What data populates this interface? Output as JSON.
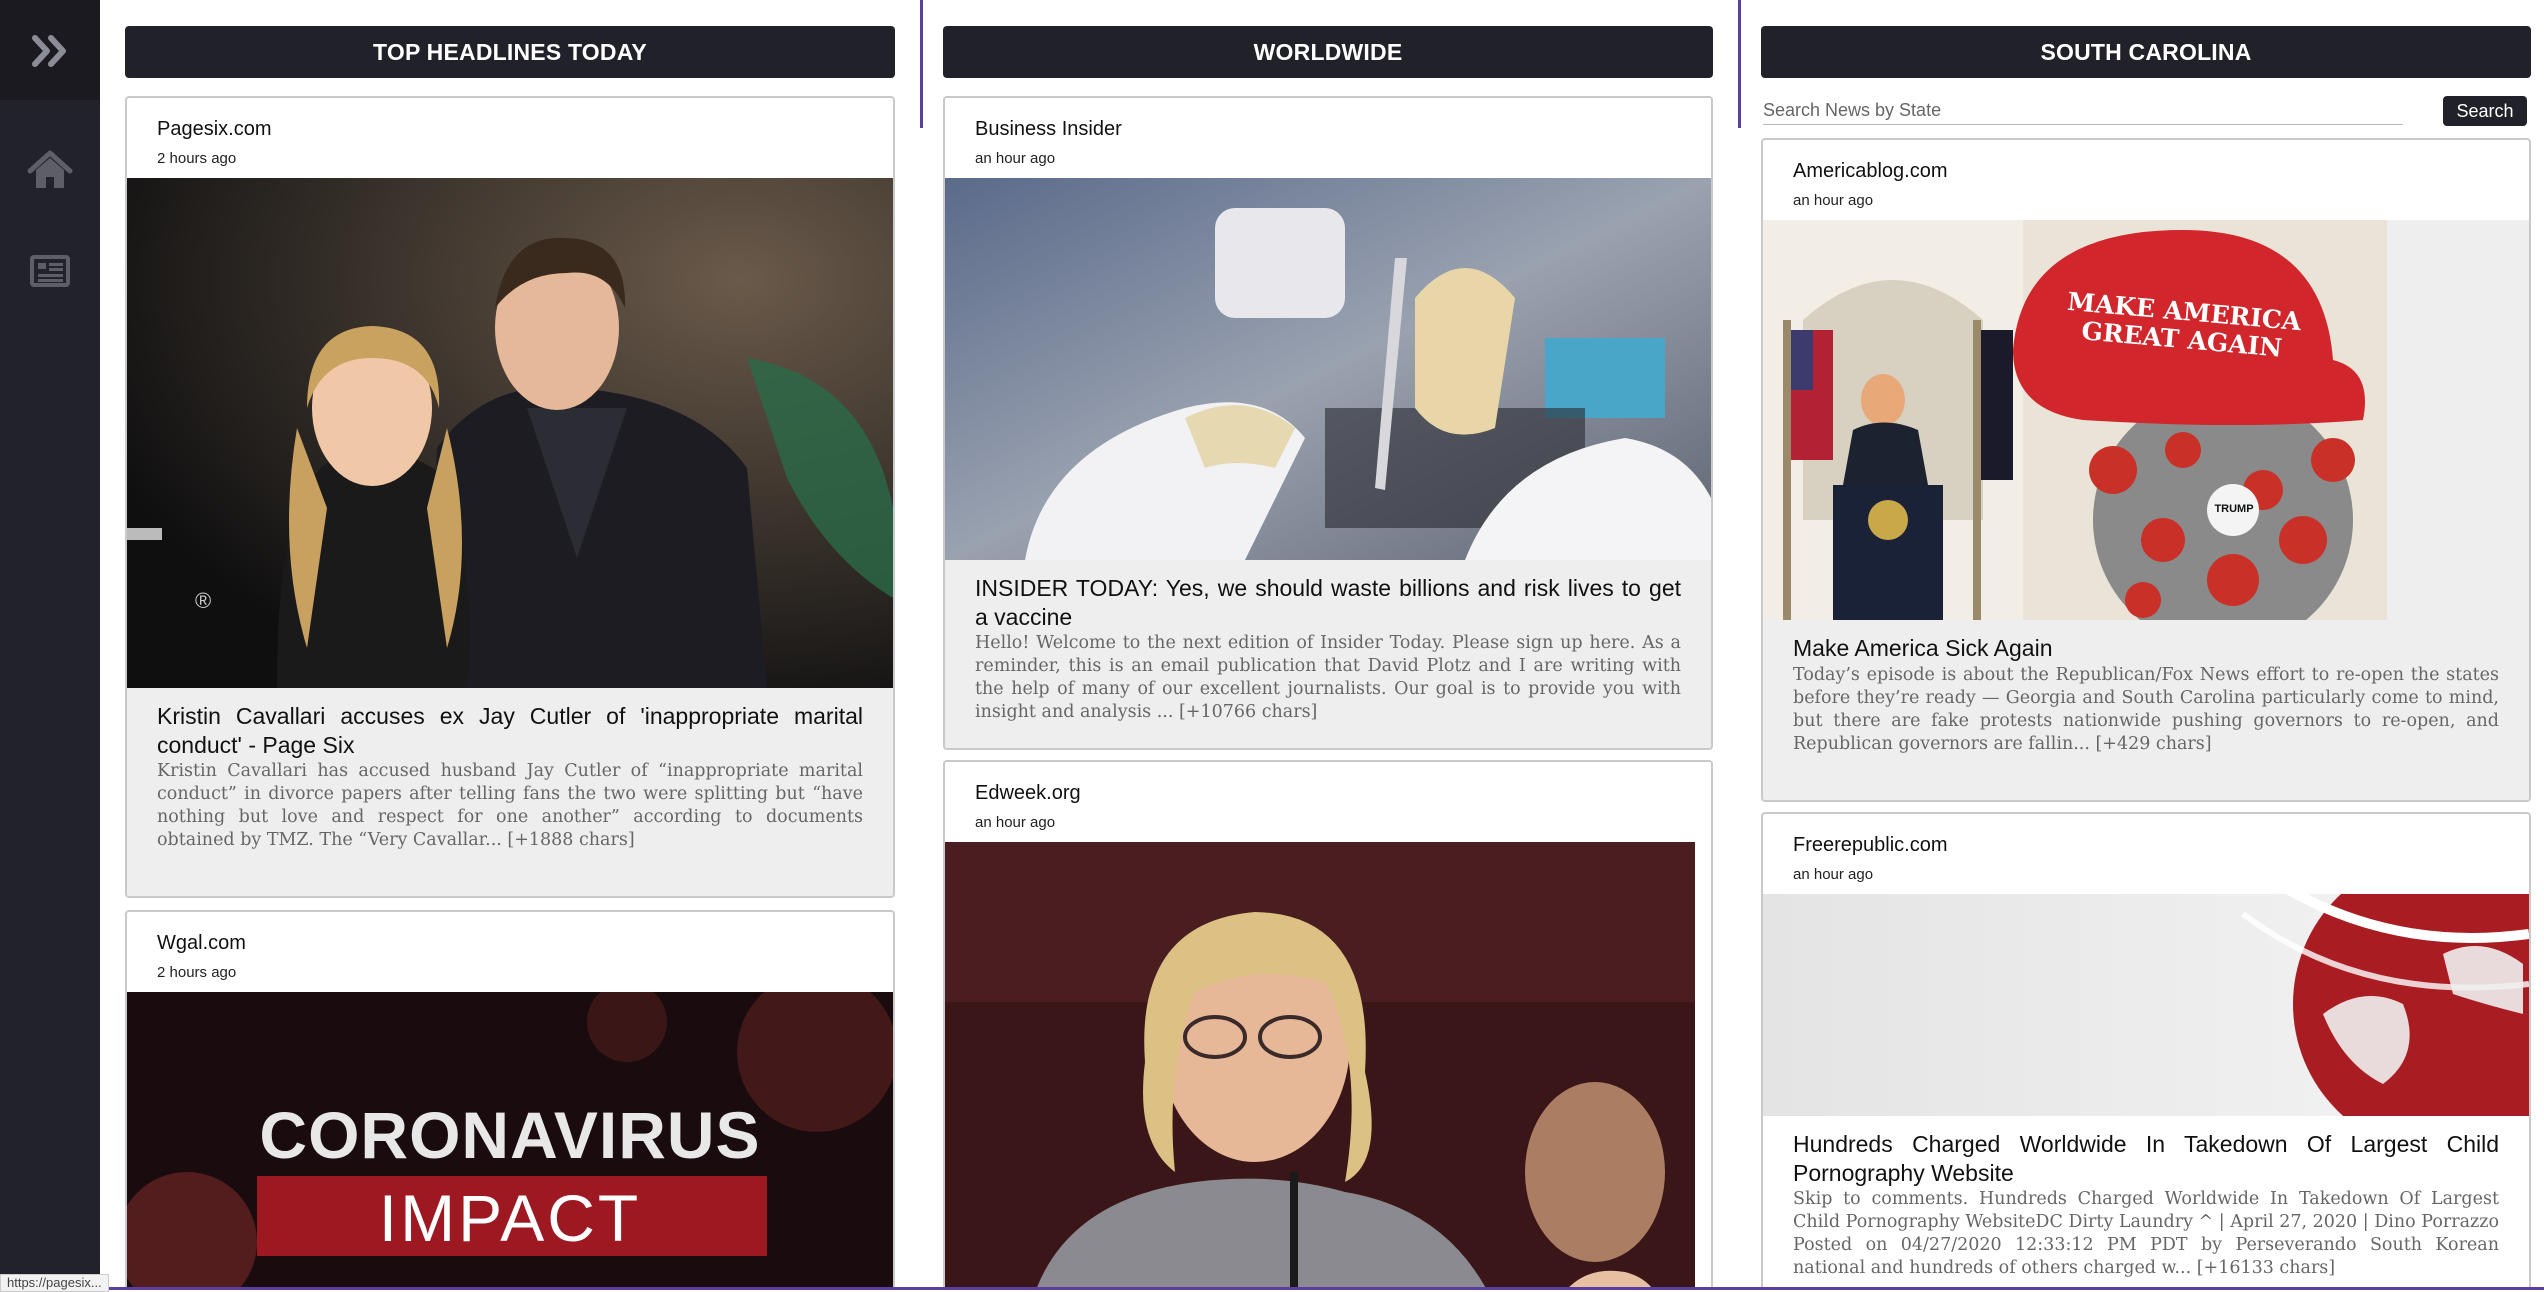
{
  "sidebar": {
    "expand_icon": "double-chevron-right-icon",
    "home_icon": "home-icon",
    "news_icon": "newspaper-icon"
  },
  "columns": [
    {
      "header": "TOP HEADLINES TODAY",
      "cards": [
        {
          "source": "Pagesix.com",
          "time": "2 hours ago",
          "image": "photo of couple at event",
          "title": "Kristin Cavallari accuses ex Jay Cutler of 'inappropriate marital conduct' - Page Six",
          "description": "Kristin Cavallari has accused husband Jay Cutler of “inappropriate marital conduct” in divorce papers after telling fans the two were splitting but “have nothing but love and respect for one another” according to documents obtained by TMZ. The “Very Cavallar... [+1888 chars]"
        },
        {
          "source": "Wgal.com",
          "time": "2 hours ago",
          "image_text_line1": "CORONAVIRUS",
          "image_text_line2": "IMPACT"
        }
      ]
    },
    {
      "header": "WORLDWIDE",
      "cards": [
        {
          "source": "Business Insider",
          "time": "an hour ago",
          "image": "lab researcher with pipette",
          "title": "INSIDER TODAY: Yes, we should waste billions and risk lives to get a vaccine",
          "description": "Hello! Welcome to the next edition of Insider Today. Please sign up here. As a reminder, this is an email publication that David Plotz and I are writing with the help of many of our excellent journalists. Our goal is to provide you with insight and analysis ... [+10766 chars]"
        },
        {
          "source": "Edweek.org",
          "time": "an hour ago",
          "image": "woman speaking at hearing"
        }
      ]
    },
    {
      "header": "SOUTH CAROLINA",
      "search": {
        "placeholder": "Search News by State",
        "button": "Search"
      },
      "cards": [
        {
          "source": "Americablog.com",
          "time": "an hour ago",
          "image_hat_line1": "MAKE AMERICA",
          "image_hat_line2": "GREAT AGAIN",
          "image_badge": "TRUMP",
          "title": "Make America Sick Again",
          "description": "Today’s episode is about the Republican/Fox News effort to re-open the states before they’re ready — Georgia and South Carolina particularly come to mind, but there are fake protests nationwide pushing governors to re-open, and Republican governors are fallin... [+429 chars]"
        },
        {
          "source": "Freerepublic.com",
          "time": "an hour ago",
          "image": "red globe graphic",
          "title": "Hundreds Charged Worldwide In Takedown Of Largest Child Pornography Website",
          "description": "Skip to comments. Hundreds Charged Worldwide In Takedown Of Largest Child Pornography WebsiteDC Dirty Laundry ^ | April 27, 2020 | Dino Porrazzo Posted on 04/27/2020 12:33:12 PM PDT by Perseverando South Korean national and hundreds of others charged w... [+16133 chars]"
        }
      ]
    }
  ],
  "status_url": "https://pagesix..."
}
